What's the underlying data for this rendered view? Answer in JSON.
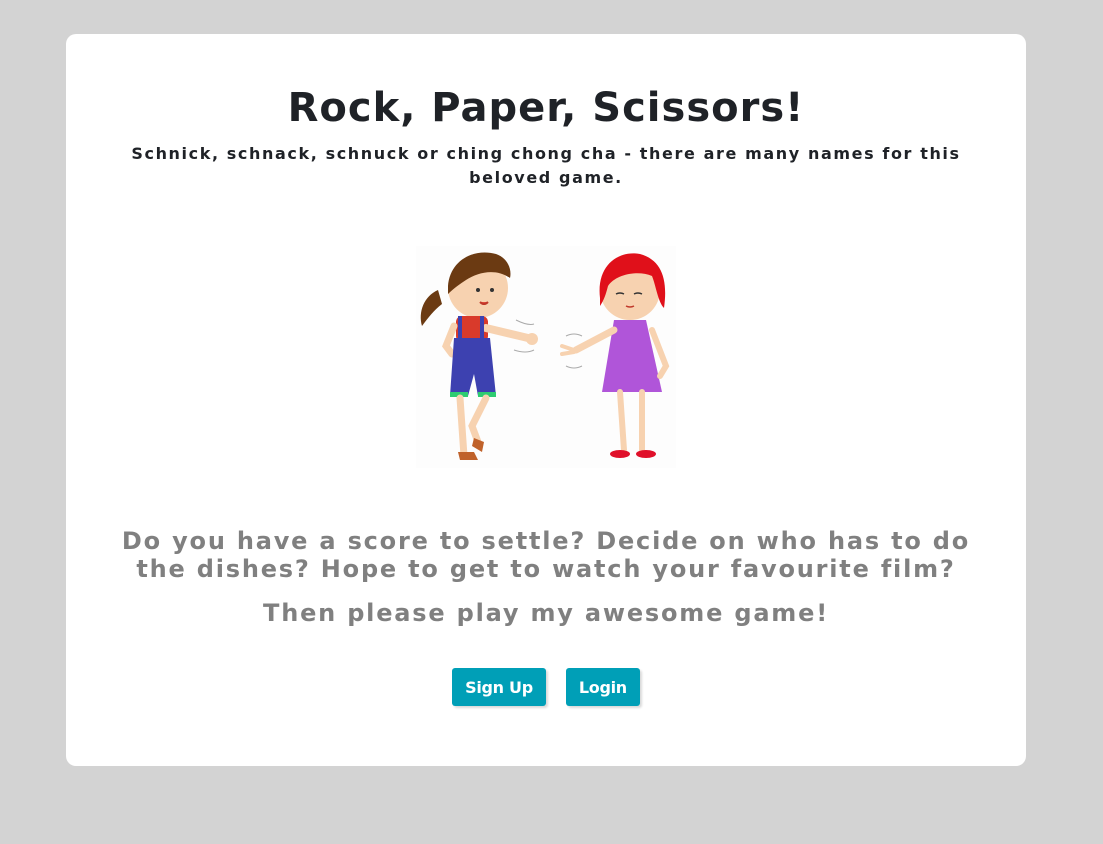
{
  "header": {
    "title": "Rock, Paper, Scissors!",
    "subtitle": "Schnick, schnack, schnuck or ching chong cha - there are many names for this beloved game."
  },
  "hero": {
    "image_alt": "Two girls playing rock paper scissors"
  },
  "body": {
    "pitch": "Do you have a score to settle? Decide on who has to do the dishes? Hope to get to watch your favourite film?",
    "call_to_action": "Then please play my awesome game!"
  },
  "actions": {
    "signup_label": "Sign Up",
    "login_label": "Login"
  },
  "colors": {
    "page_background": "#d3d3d3",
    "card_background": "#ffffff",
    "title_text": "#1f2227",
    "body_text": "#808080",
    "button_background": "#009fb7",
    "button_text": "#ffffff"
  }
}
